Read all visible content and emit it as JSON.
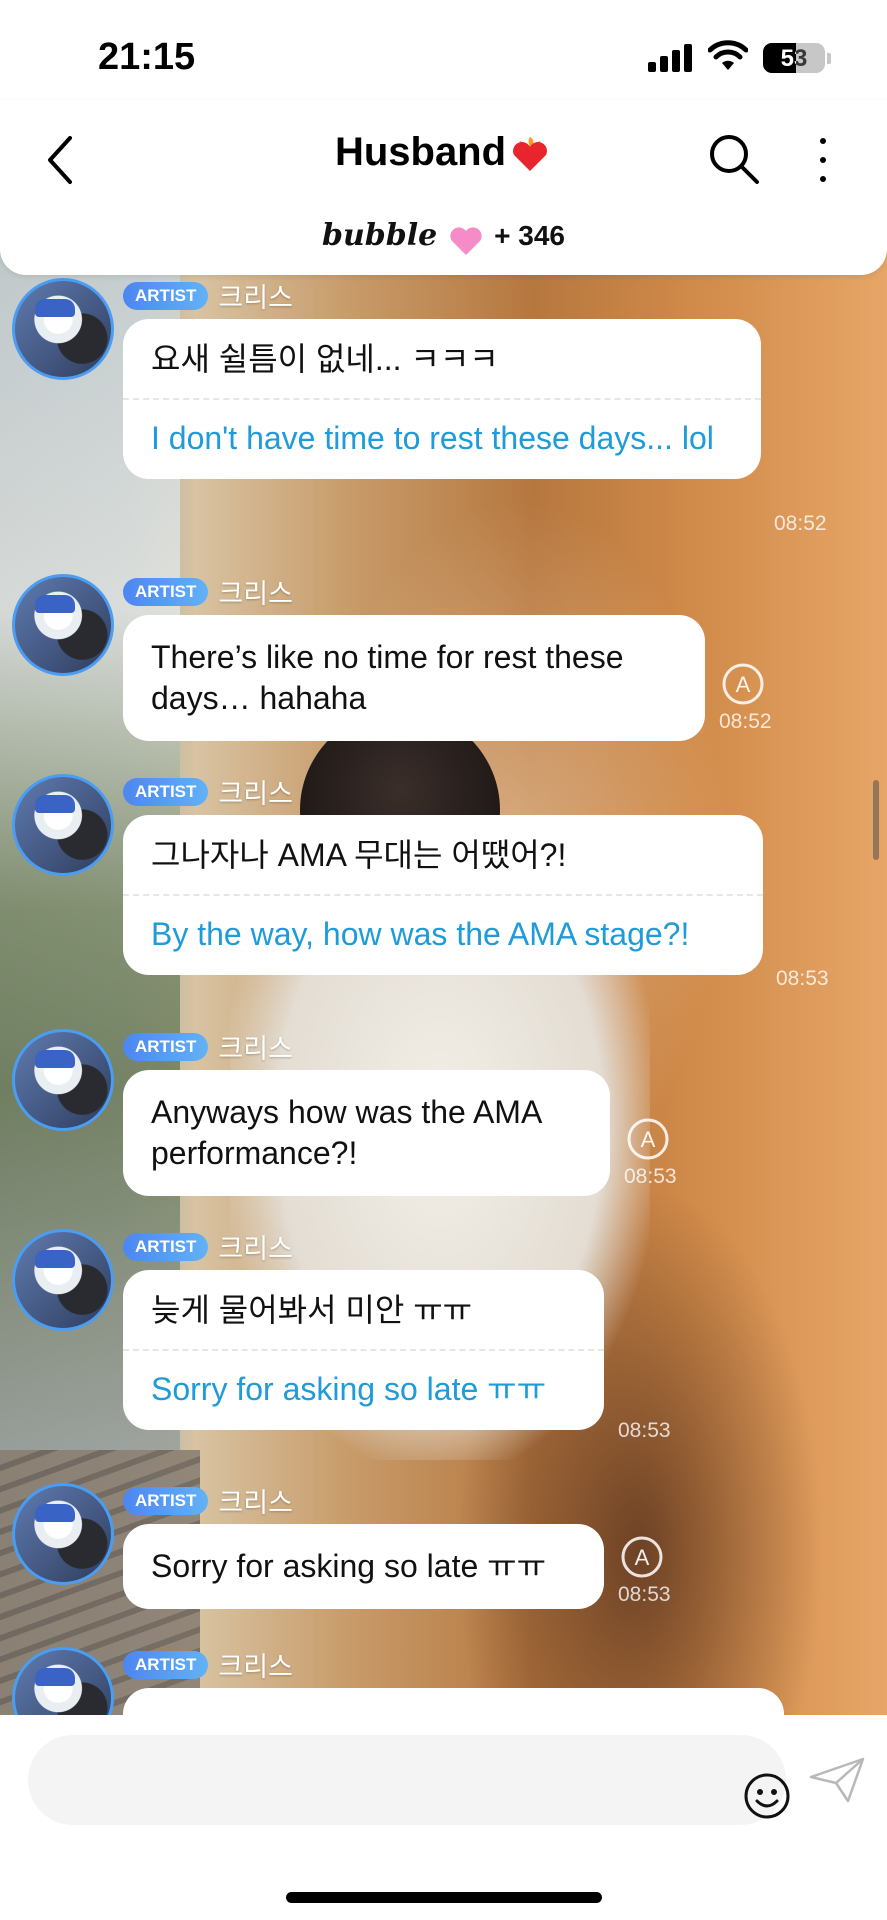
{
  "status_bar": {
    "time": "21:15",
    "battery": "53"
  },
  "header": {
    "title": "Husband",
    "title_emoji": "heart-on-fire-emoji",
    "service": "bubble",
    "subscriber_count": "+ 346"
  },
  "messages": [
    {
      "badge": "ARTIST",
      "sender": "크리스",
      "original": "요새 쉴틈이 없네... ㅋㅋㅋ",
      "translation": "I don't have time to rest these days... lol",
      "time": "08:52",
      "type": "translated"
    },
    {
      "badge": "ARTIST",
      "sender": "크리스",
      "original": "There’s like no time for rest these days… hahaha",
      "time": "08:52",
      "type": "english"
    },
    {
      "badge": "ARTIST",
      "sender": "크리스",
      "original": "그나자나 AMA 무대는 어땠어?!",
      "translation": "By the way, how was the AMA stage?!",
      "time": "08:53",
      "type": "translated"
    },
    {
      "badge": "ARTIST",
      "sender": "크리스",
      "original": "Anyways how was the AMA performance?!",
      "time": "08:53",
      "type": "english"
    },
    {
      "badge": "ARTIST",
      "sender": "크리스",
      "original": "늦게 물어봐서 미안 ㅠㅠ",
      "translation": "Sorry for asking so late ㅠㅠ",
      "time": "08:53",
      "type": "translated"
    },
    {
      "badge": "ARTIST",
      "sender": "크리스",
      "original": "Sorry for asking so late ㅠㅠ",
      "time": "08:53",
      "type": "english"
    },
    {
      "badge": "ARTIST",
      "sender": "크리스"
    }
  ],
  "icons": {
    "back": "back-chevron-icon",
    "search": "search-icon",
    "more": "more-vertical-icon",
    "emoji": "emoji-icon",
    "send": "send-icon",
    "translate": "translate-icon"
  },
  "colors": {
    "badge": "#4d86f2",
    "translation_text": "#1e9bd8",
    "avatar_ring": "#4a9df2"
  }
}
